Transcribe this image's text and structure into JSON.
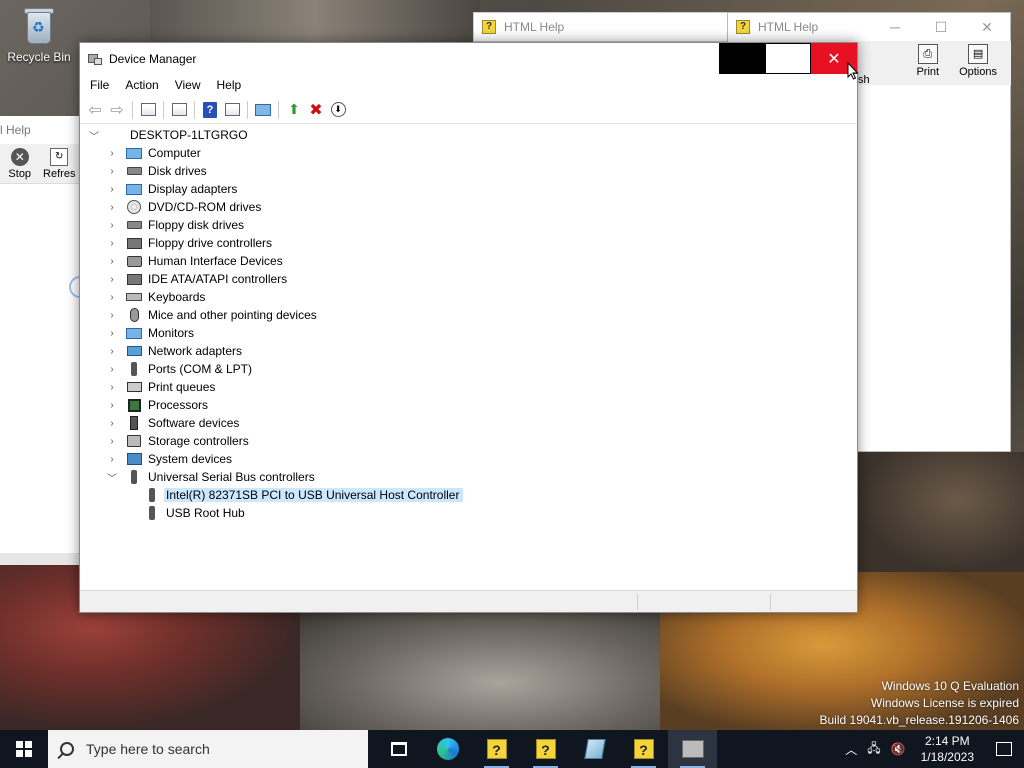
{
  "desktop": {
    "recycle_bin_label": "Recycle Bin",
    "watermark": [
      "Windows 10 Q Evaluation",
      "Windows License is expired",
      "Build 19041.vb_release.191206-1406"
    ]
  },
  "help_left": {
    "title": "l Help",
    "stop_label": "Stop",
    "refresh_label": "Refres"
  },
  "help_r1": {
    "title": "HTML Help"
  },
  "help_r2": {
    "title": "HTML Help",
    "partial_label": "sh",
    "print_label": "Print",
    "options_label": "Options"
  },
  "device_manager": {
    "title": "Device Manager",
    "menu": [
      "File",
      "Action",
      "View",
      "Help"
    ],
    "root": "DESKTOP-1LTGRGO",
    "categories": [
      "Computer",
      "Disk drives",
      "Display adapters",
      "DVD/CD-ROM drives",
      "Floppy disk drives",
      "Floppy drive controllers",
      "Human Interface Devices",
      "IDE ATA/ATAPI controllers",
      "Keyboards",
      "Mice and other pointing devices",
      "Monitors",
      "Network adapters",
      "Ports (COM & LPT)",
      "Print queues",
      "Processors",
      "Software devices",
      "Storage controllers",
      "System devices",
      "Universal Serial Bus controllers"
    ],
    "usb_children": [
      "Intel(R) 82371SB PCI to USB Universal Host Controller",
      "USB Root Hub"
    ]
  },
  "taskbar": {
    "search_placeholder": "Type here to search",
    "time": "2:14 PM",
    "date": "1/18/2023"
  }
}
